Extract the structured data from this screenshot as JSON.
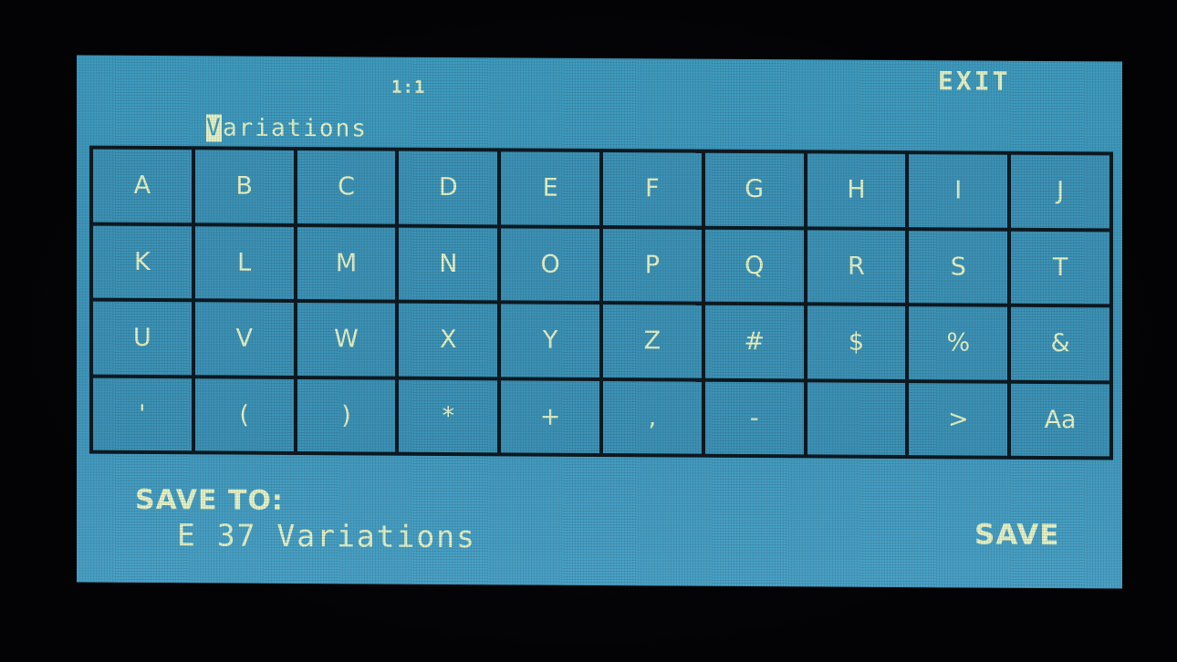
{
  "header": {
    "counter": "1:1",
    "name_cursor_char": "V",
    "name_rest": "ariations",
    "exit_label": "EXIT"
  },
  "keyboard": {
    "rows": [
      [
        "A",
        "B",
        "C",
        "D",
        "E",
        "F",
        "G",
        "H",
        "I",
        "J"
      ],
      [
        "K",
        "L",
        "M",
        "N",
        "O",
        "P",
        "Q",
        "R",
        "S",
        "T"
      ],
      [
        "U",
        "V",
        "W",
        "X",
        "Y",
        "Z",
        "#",
        "$",
        "%",
        "&"
      ],
      [
        "'",
        "(",
        ")",
        "*",
        "+",
        ",",
        "-",
        "",
        ">",
        "Aa"
      ]
    ]
  },
  "footer": {
    "save_to_label": "SAVE TO:",
    "save_to_value": "E 37 Variations",
    "save_label": "SAVE"
  },
  "colors": {
    "screen_bg": "#3f9cc0",
    "key_bg": "#3d94b8",
    "grid_lines": "#0c1a22",
    "text": "#e8f4c8"
  }
}
